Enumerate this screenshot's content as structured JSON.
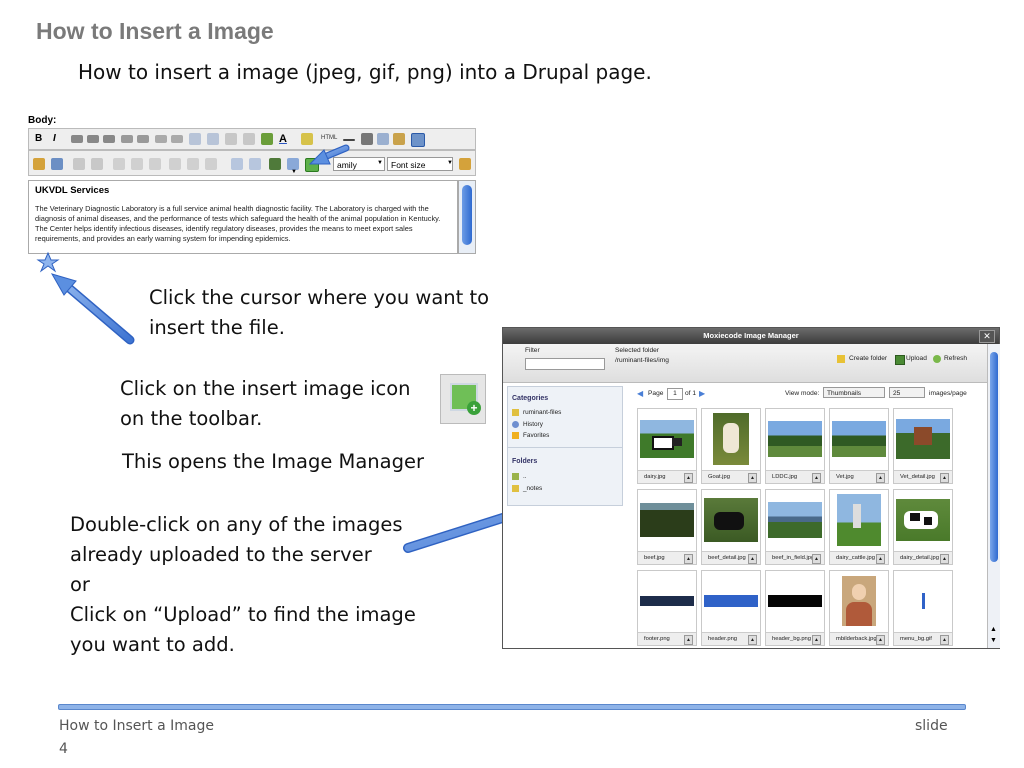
{
  "slide": {
    "title": "How to Insert a Image",
    "subtitle": "How to insert a image (jpeg, gif, png) into a Drupal page.",
    "instructions": {
      "click_cursor_1": "Click the cursor where you want to",
      "click_cursor_2": "insert the file.",
      "insert_icon_1": "Click on the insert image icon",
      "insert_icon_2": "on the toolbar.",
      "opens_manager": "This opens the Image Manager",
      "dbl_1": "Double-click on any of the images",
      "dbl_2": "already uploaded to the server",
      "dbl_or": "or",
      "upload_1": "Click on “Upload” to find the image",
      "upload_2": "you want to add."
    },
    "footer": {
      "left": "How to Insert a Image",
      "right": "slide",
      "page": "4"
    }
  },
  "editor": {
    "body_label": "Body:",
    "font_family_partial": "amily",
    "font_size": "Font size",
    "content_heading": "UKVDL Services",
    "content_text": "The Veterinary Diagnostic Laboratory is a full service animal health diagnostic facility. The Laboratory is charged with the diagnosis of animal diseases, and the performance of tests which safeguard the health of the animal population in Kentucky. The Center helps identify infectious diseases, identify regulatory diseases, provides the means to meet export sales requirements, and provides an early warning system for impending epidemics."
  },
  "image_manager": {
    "title": "Moxiecode Image Manager",
    "filter_label": "Filter",
    "selected_folder_label": "Selected folder",
    "selected_folder_path": "/ruminant-files/img",
    "create_folder": "Create folder",
    "upload": "Upload",
    "refresh": "Refresh",
    "page_label": "Page",
    "page_value": "1",
    "page_of": "of 1",
    "view_mode_label": "View mode:",
    "view_mode_value": "Thumbnails",
    "per_page_value": "25",
    "per_page_label": "images/page",
    "categories_heading": "Categories",
    "categories": [
      "ruminant-files",
      "History",
      "Favorites"
    ],
    "folders_heading": "Folders",
    "folders": [
      "..",
      "_notes"
    ],
    "thumbnails": [
      {
        "name": "dairy.jpg",
        "kind": "cows-field"
      },
      {
        "name": "Goat.jpg",
        "kind": "goat"
      },
      {
        "name": "LDDC.jpg",
        "kind": "landscape"
      },
      {
        "name": "Vet.jpg",
        "kind": "landscape"
      },
      {
        "name": "Vet_detail.jpg",
        "kind": "building"
      },
      {
        "name": "beef.jpg",
        "kind": "dark-field"
      },
      {
        "name": "beef_detail.jpg",
        "kind": "black-cow"
      },
      {
        "name": "beef_in_field.jpg",
        "kind": "city-field"
      },
      {
        "name": "dairy_cattle.jpg",
        "kind": "silo"
      },
      {
        "name": "dairy_detail.jpg",
        "kind": "holstein"
      },
      {
        "name": "footer.png",
        "kind": "footer-strip"
      },
      {
        "name": "header.png",
        "kind": "blue-strip"
      },
      {
        "name": "header_bg.png",
        "kind": "black-strip"
      },
      {
        "name": "mbilderback.jpg",
        "kind": "portrait"
      },
      {
        "name": "menu_bg.gif",
        "kind": "blue-line"
      }
    ]
  },
  "colors": {
    "title_gray": "#7a7a7a",
    "arrow_blue": "#5b8fe0",
    "footer_bar": "#8eb3e8"
  }
}
